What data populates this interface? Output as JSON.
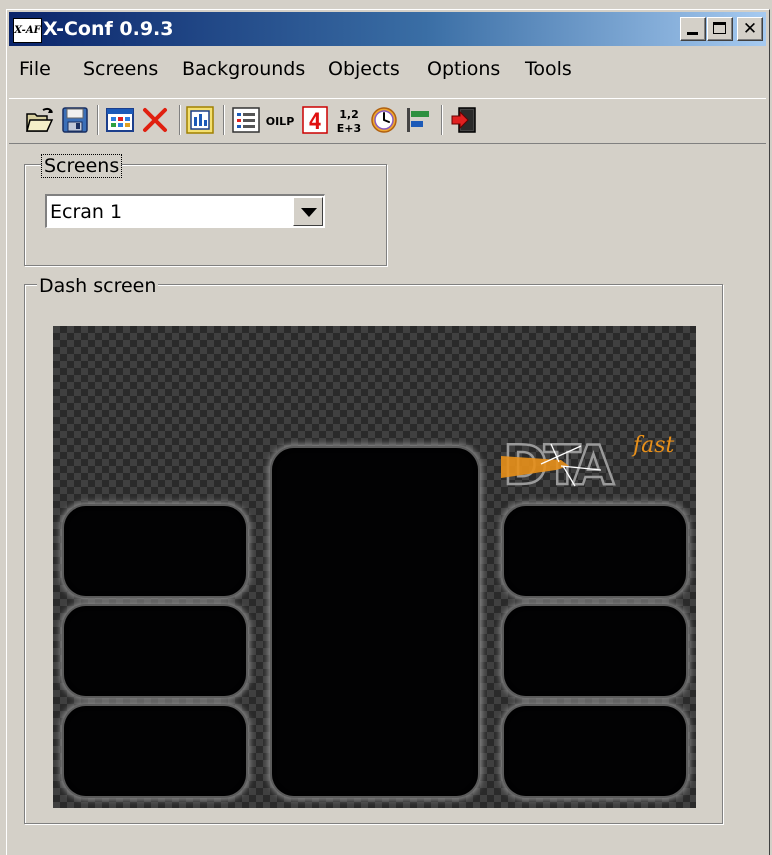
{
  "window": {
    "title": "X-Conf 0.9.3",
    "app_icon_text": "X-AF",
    "controls": {
      "minimize": "minimize-icon",
      "maximize": "maximize-icon",
      "close": "close-icon",
      "close_glyph": "✕"
    }
  },
  "menu": [
    "File",
    "Screens",
    "Backgrounds",
    "Objects",
    "Options",
    "Tools"
  ],
  "toolbar": {
    "icons": [
      "open-folder-icon",
      "save-disk-icon",
      "new-screen-grid-icon",
      "delete-x-icon",
      "screen-properties-icon",
      "list-object-icon",
      "oilp-object-icon",
      "digit-object-icon",
      "numeric-object-icon",
      "clock-object-icon",
      "bargraph-object-icon",
      "exit-icon"
    ],
    "oilp_label": "OILP",
    "digit_label": "4",
    "numeric_top": "1,2",
    "numeric_bottom": "E+3"
  },
  "screens_group": {
    "legend": "Screens",
    "selected": "Ecran 1"
  },
  "dash_group": {
    "legend": "Dash screen",
    "logo_text": "DTA",
    "logo_sub": "fast"
  },
  "colors": {
    "face": "#d4d0c8",
    "title_start": "#0a246a",
    "title_end": "#a6caf0",
    "dash_dark": "#2a2a2a",
    "dash_light": "#404040",
    "logo_orange": "#e8901a"
  }
}
